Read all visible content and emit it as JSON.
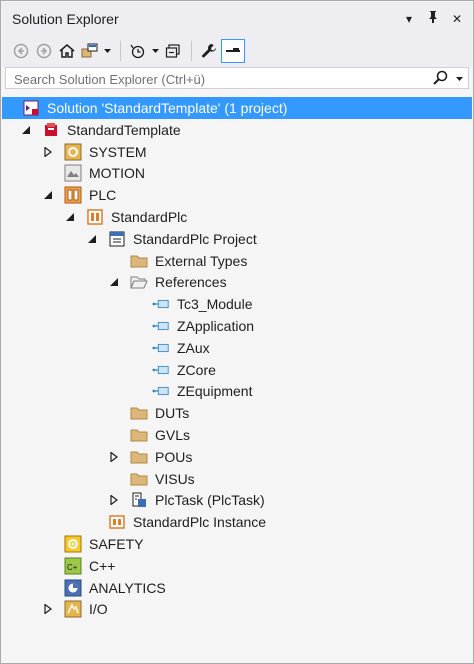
{
  "window": {
    "title": "Solution Explorer",
    "pin_label": "⊥",
    "close_label": "✕",
    "menu_label": "▾"
  },
  "search": {
    "placeholder": "Search Solution Explorer (Ctrl+ü)"
  },
  "tree": [
    {
      "label": "Solution 'StandardTemplate' (1 project)",
      "level": 0,
      "expander": "none",
      "icon": "solution-icon",
      "selected": true
    },
    {
      "label": "StandardTemplate",
      "level": 0,
      "expander": "expanded",
      "icon": "twincat-project-icon"
    },
    {
      "label": "SYSTEM",
      "level": 1,
      "expander": "collapsed",
      "icon": "system-icon"
    },
    {
      "label": "MOTION",
      "level": 1,
      "expander": "none",
      "icon": "motion-icon"
    },
    {
      "label": "PLC",
      "level": 1,
      "expander": "expanded",
      "icon": "plc-icon"
    },
    {
      "label": "StandardPlc",
      "level": 2,
      "expander": "expanded",
      "icon": "plc-project-icon"
    },
    {
      "label": "StandardPlc Project",
      "level": 3,
      "expander": "expanded",
      "icon": "plc-project-file-icon"
    },
    {
      "label": "External Types",
      "level": 4,
      "expander": "none",
      "icon": "folder-icon"
    },
    {
      "label": "References",
      "level": 4,
      "expander": "expanded",
      "icon": "folder-open-icon"
    },
    {
      "label": "Tc3_Module",
      "level": 5,
      "expander": "none",
      "icon": "library-reference-icon"
    },
    {
      "label": "ZApplication",
      "level": 5,
      "expander": "none",
      "icon": "library-reference-icon"
    },
    {
      "label": "ZAux",
      "level": 5,
      "expander": "none",
      "icon": "library-reference-icon"
    },
    {
      "label": "ZCore",
      "level": 5,
      "expander": "none",
      "icon": "library-reference-icon"
    },
    {
      "label": "ZEquipment",
      "level": 5,
      "expander": "none",
      "icon": "library-reference-icon"
    },
    {
      "label": "DUTs",
      "level": 4,
      "expander": "none",
      "icon": "folder-icon"
    },
    {
      "label": "GVLs",
      "level": 4,
      "expander": "none",
      "icon": "folder-icon"
    },
    {
      "label": "POUs",
      "level": 4,
      "expander": "collapsed",
      "icon": "folder-icon"
    },
    {
      "label": "VISUs",
      "level": 4,
      "expander": "none",
      "icon": "folder-icon"
    },
    {
      "label": "PlcTask (PlcTask)",
      "level": 4,
      "expander": "collapsed",
      "icon": "plc-task-icon"
    },
    {
      "label": "StandardPlc Instance",
      "level": 3,
      "expander": "none",
      "icon": "plc-instance-icon"
    },
    {
      "label": "SAFETY",
      "level": 1,
      "expander": "none",
      "icon": "safety-icon"
    },
    {
      "label": "C++",
      "level": 1,
      "expander": "none",
      "icon": "cpp-icon"
    },
    {
      "label": "ANALYTICS",
      "level": 1,
      "expander": "none",
      "icon": "analytics-icon"
    },
    {
      "label": "I/O",
      "level": 1,
      "expander": "collapsed",
      "icon": "io-icon"
    }
  ],
  "colors": {
    "selection": "#3399ff",
    "folder": "#dcb67a",
    "twincat_red": "#c8102e",
    "plc_orange": "#e07b28"
  }
}
